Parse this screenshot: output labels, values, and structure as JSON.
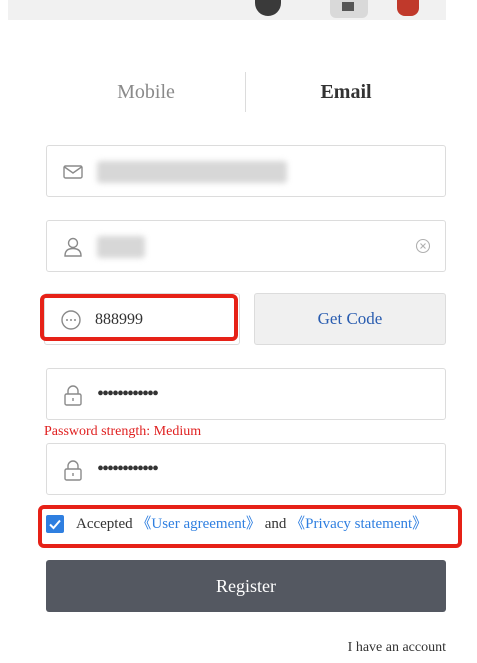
{
  "tabs": {
    "mobile": "Mobile",
    "email": "Email",
    "active": "email"
  },
  "email_field": {
    "value": ""
  },
  "username_field": {
    "value": ""
  },
  "code_field": {
    "value": "888999"
  },
  "get_code_button": "Get Code",
  "password_field": {
    "masked": "••••••••••••"
  },
  "password_strength": "Password strength: Medium",
  "confirm_field": {
    "masked": "••••••••••••"
  },
  "agreement": {
    "checked": true,
    "prefix": "Accepted",
    "user_agreement": "《User agreement》",
    "joiner": "and",
    "privacy_statement": "《Privacy statement》"
  },
  "register_button": "Register",
  "have_account_link": "I have an account",
  "colors": {
    "accent": "#2f7fe0",
    "highlight": "#e62117",
    "button": "#545861",
    "warning": "#e02020"
  },
  "icons": {
    "email": "mail-icon",
    "user": "user-icon",
    "code": "message-dots-icon",
    "password": "lock-icon",
    "clear": "clear-circle-icon",
    "checkbox": "check-icon"
  }
}
